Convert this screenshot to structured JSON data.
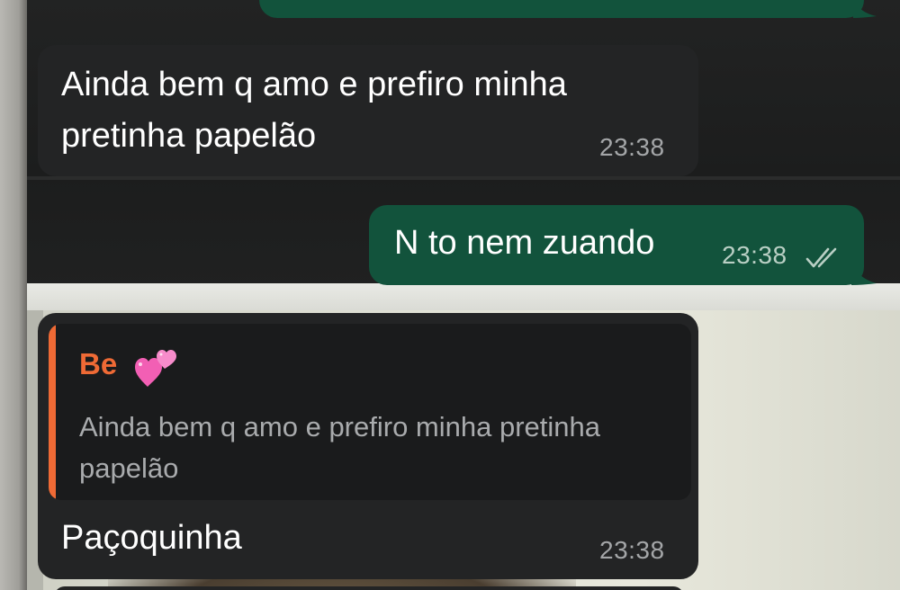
{
  "messages": [
    {
      "direction": "incoming",
      "lines": [
        "Ainda bem q amo e prefiro minha",
        "pretinha papelão"
      ],
      "time": "23:38"
    },
    {
      "direction": "outgoing",
      "text": "N to nem zuando",
      "time": "23:38",
      "status": "read-double-check-icon"
    },
    {
      "direction": "incoming",
      "reply": {
        "author": "Be",
        "author_emoji": "two-hearts-emoji",
        "lines": [
          "Ainda bem q amo e prefiro minha pretinha",
          "papelão"
        ]
      },
      "text": "Paçoquinha",
      "time": "23:38"
    }
  ],
  "colors": {
    "incoming_bubble": "#232425",
    "outgoing_bubble": "#12533c",
    "quote_accent": "#ef6a35",
    "timestamp": "#a4a6a8"
  }
}
